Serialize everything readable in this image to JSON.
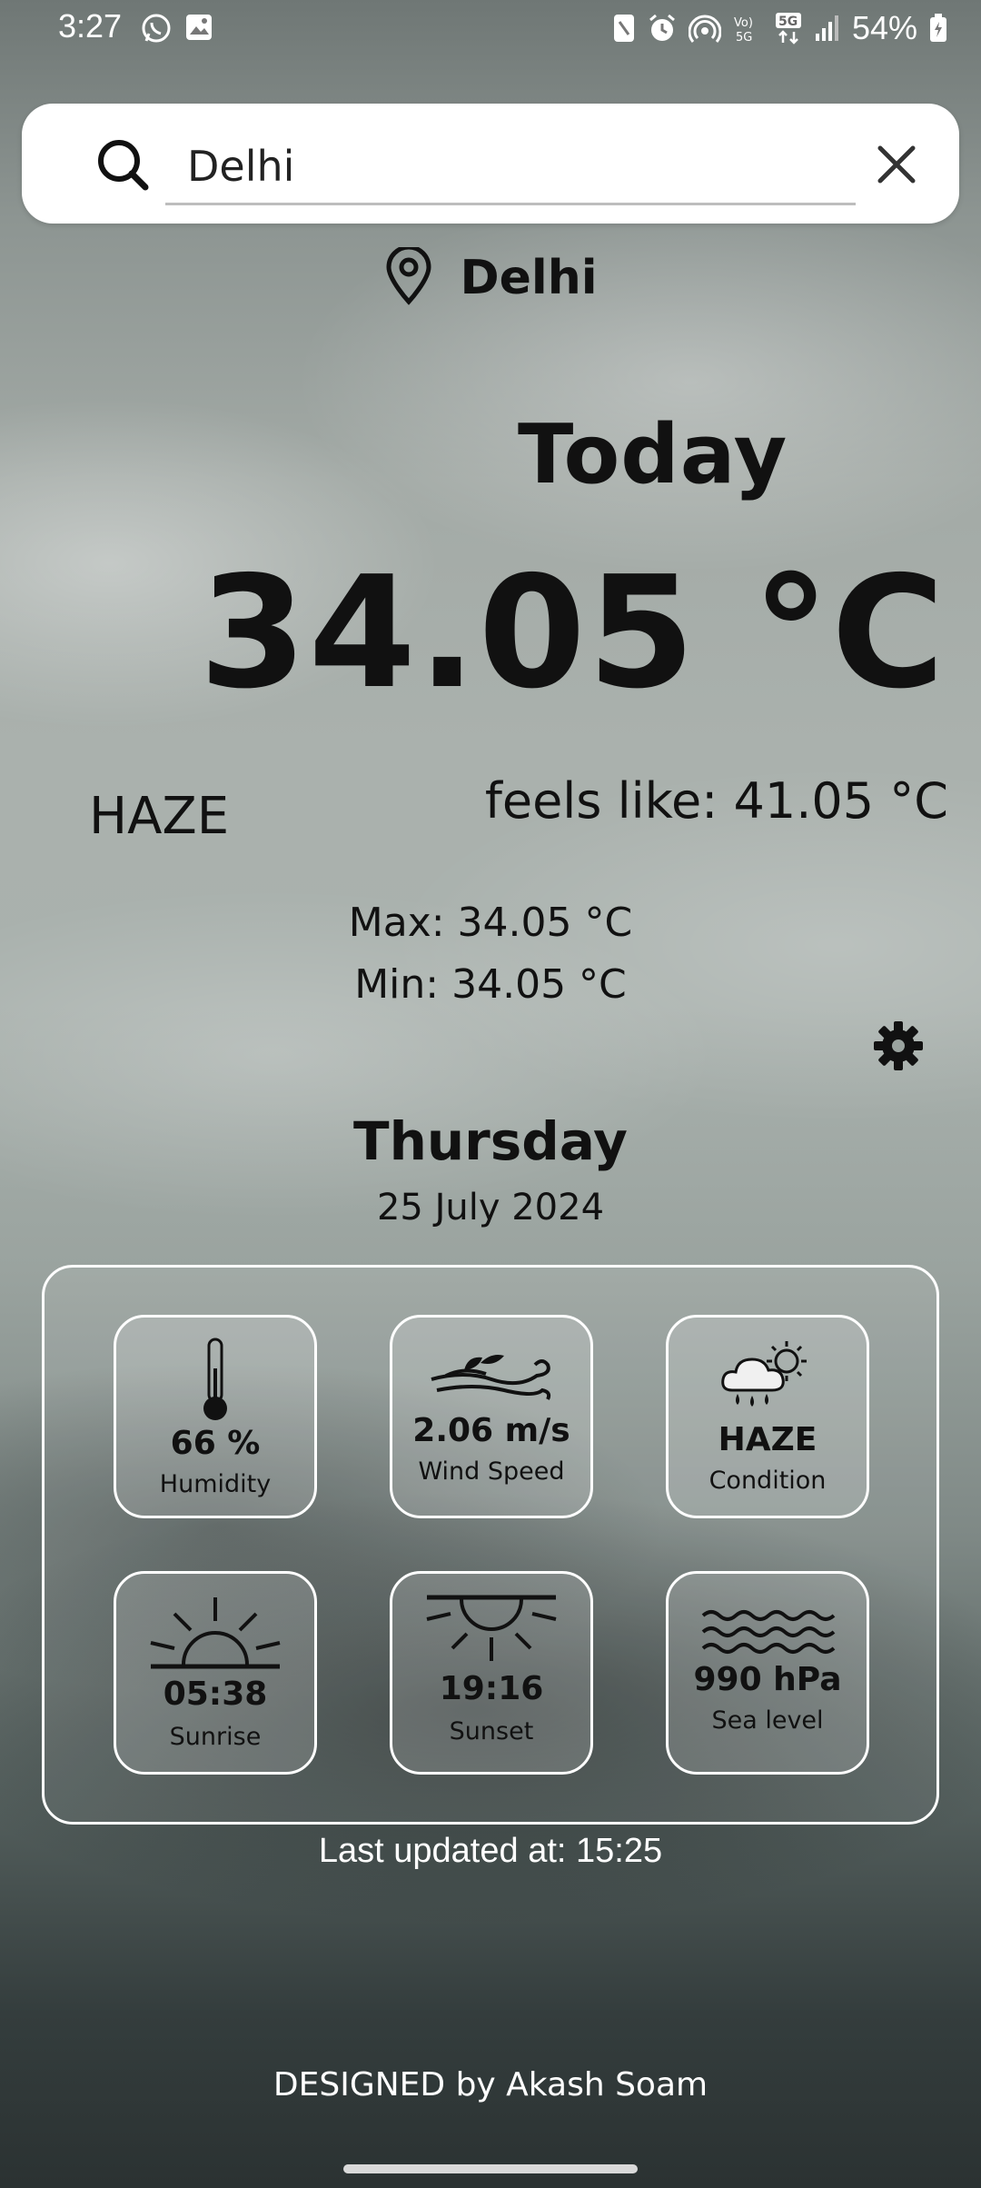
{
  "status_bar": {
    "time": "3:27",
    "battery": "54%",
    "left_icons": [
      "whatsapp-icon",
      "gallery-icon"
    ],
    "right_icons": [
      "nfc-icon",
      "alarm-icon",
      "hotspot-icon",
      "volte-icon",
      "5g-icon",
      "signal-icon",
      "battery-icon"
    ],
    "network_5g": "5G",
    "volte": "Vo) 5G"
  },
  "search": {
    "value": "Delhi",
    "placeholder": ""
  },
  "location": {
    "name": "Delhi"
  },
  "weather": {
    "today_label": "Today",
    "temperature": "34.05 °C",
    "condition": "HAZE",
    "feels_like": "feels like: 41.05 °C",
    "max": "Max: 34.05 °C",
    "min": "Min: 34.05 °C"
  },
  "date": {
    "day": "Thursday",
    "full_date": "25 July 2024"
  },
  "details": {
    "humidity": {
      "value": "66 %",
      "caption": "Humidity",
      "icon": "thermometer-icon"
    },
    "wind": {
      "value": "2.06 m/s",
      "caption": "Wind Speed",
      "icon": "wind-icon"
    },
    "condition": {
      "value": "HAZE",
      "caption": "Condition",
      "icon": "cloud-rain-sun-icon"
    },
    "sunrise": {
      "value": "05:38",
      "caption": "Sunrise",
      "icon": "sunrise-icon"
    },
    "sunset": {
      "value": "19:16",
      "caption": "Sunset",
      "icon": "sunset-icon"
    },
    "sea_level": {
      "value": "990 hPa",
      "caption": "Sea level",
      "icon": "waves-icon"
    }
  },
  "footer": {
    "last_updated": "Last updated at: 15:25",
    "designed_by": "DESIGNED by Akash Soam"
  },
  "colors": {
    "tile_border": "#ffffff",
    "text_dark": "#111111",
    "text_light": "#ffffff"
  }
}
